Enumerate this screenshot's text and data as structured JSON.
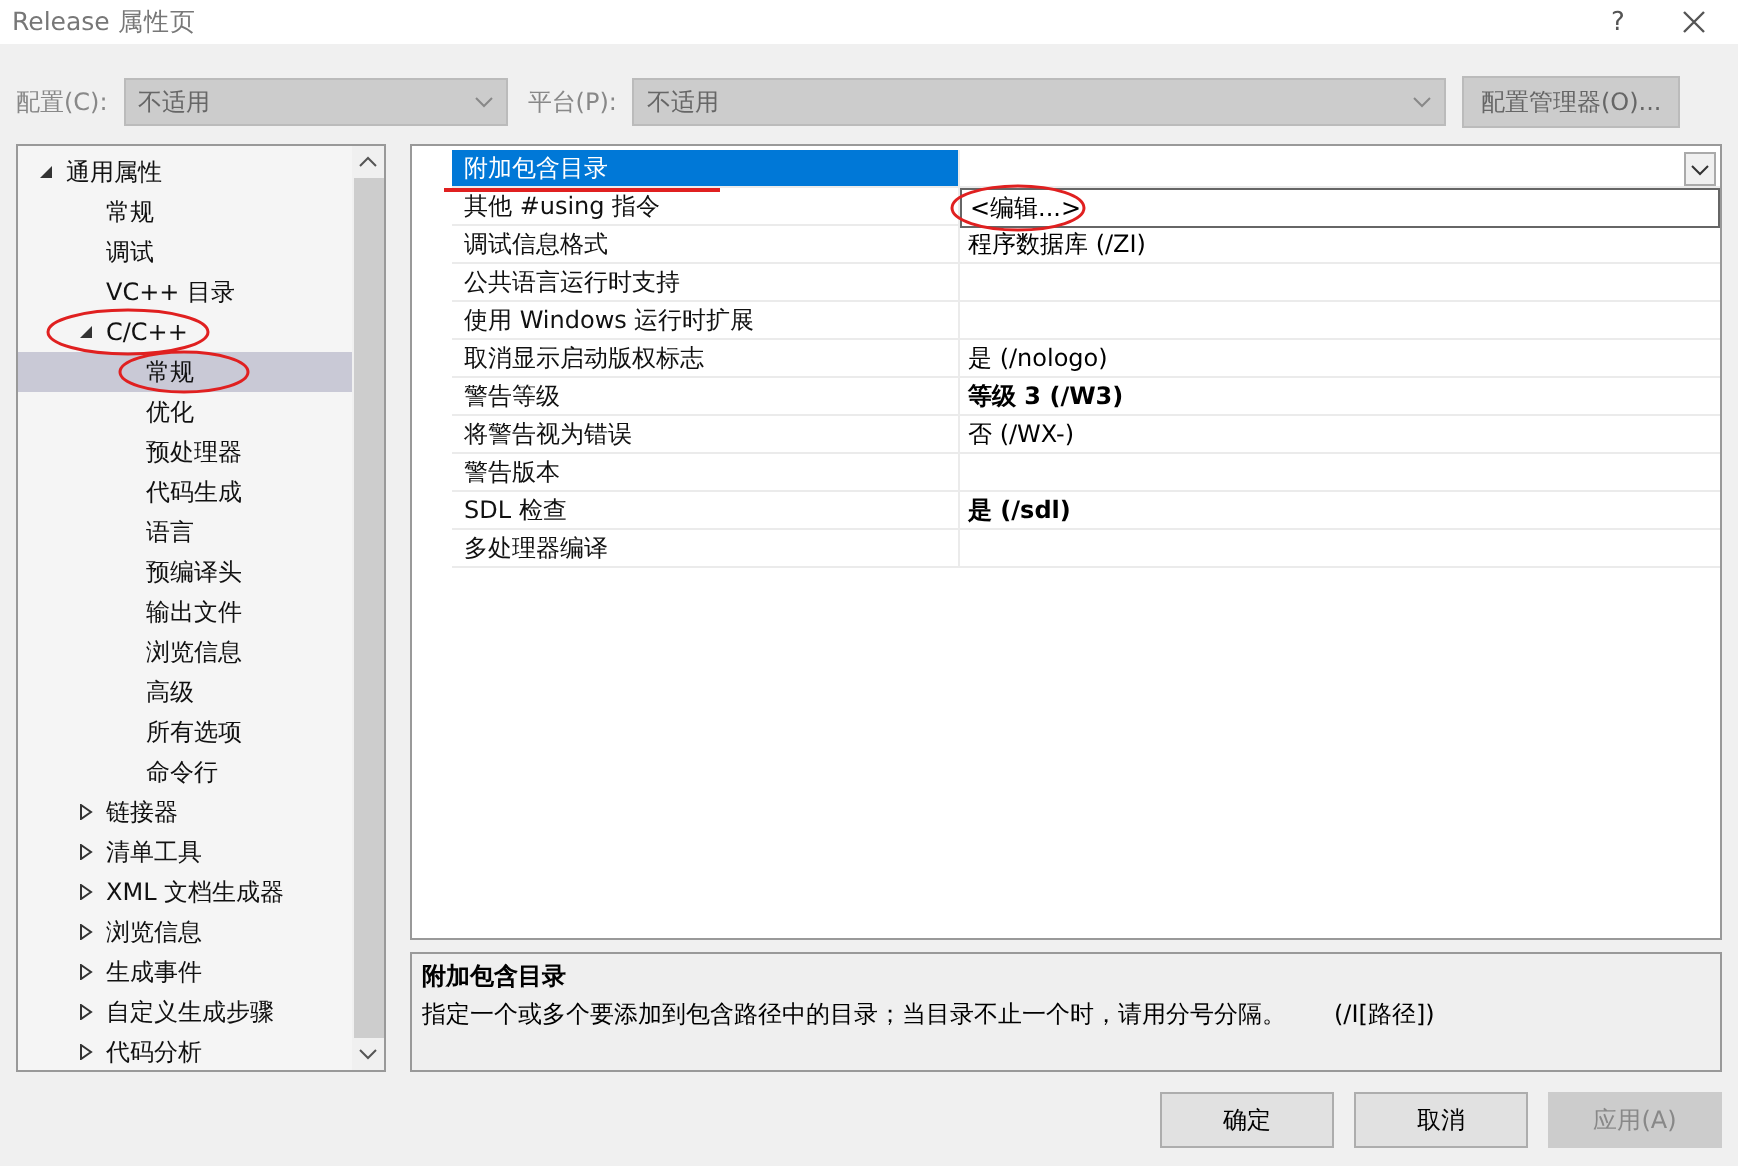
{
  "window": {
    "title": "Release 属性页",
    "help": "?"
  },
  "config_bar": {
    "config_label": "配置(C):",
    "config_value": "不适用",
    "platform_label": "平台(P):",
    "platform_value": "不适用",
    "manager_button": "配置管理器(O)...",
    "disabled": true
  },
  "tree": [
    {
      "label": "通用属性",
      "expanded": true,
      "selected": false,
      "children": [
        {
          "label": "常规",
          "selected": false
        },
        {
          "label": "调试",
          "selected": false
        },
        {
          "label": "VC++ 目录",
          "selected": false
        },
        {
          "label": "C/C++",
          "expanded": true,
          "selected": false,
          "annotated": true,
          "children": [
            {
              "label": "常规",
              "selected": true,
              "annotated": true
            },
            {
              "label": "优化",
              "selected": false
            },
            {
              "label": "预处理器",
              "selected": false
            },
            {
              "label": "代码生成",
              "selected": false
            },
            {
              "label": "语言",
              "selected": false
            },
            {
              "label": "预编译头",
              "selected": false
            },
            {
              "label": "输出文件",
              "selected": false
            },
            {
              "label": "浏览信息",
              "selected": false
            },
            {
              "label": "高级",
              "selected": false
            },
            {
              "label": "所有选项",
              "selected": false
            },
            {
              "label": "命令行",
              "selected": false
            }
          ]
        },
        {
          "label": "链接器",
          "expanded": false,
          "selected": false
        },
        {
          "label": "清单工具",
          "expanded": false,
          "selected": false
        },
        {
          "label": "XML 文档生成器",
          "expanded": false,
          "selected": false
        },
        {
          "label": "浏览信息",
          "expanded": false,
          "selected": false
        },
        {
          "label": "生成事件",
          "expanded": false,
          "selected": false
        },
        {
          "label": "自定义生成步骤",
          "expanded": false,
          "selected": false
        },
        {
          "label": "代码分析",
          "expanded": false,
          "selected": false
        }
      ]
    }
  ],
  "properties": [
    {
      "name": "附加包含目录",
      "selected": true,
      "annotated": true
    },
    {
      "name": "其他 #using 指令",
      "selected": false
    },
    {
      "name": "调试信息格式",
      "value": "程序数据库 (/ZI)",
      "selected": false,
      "bold": false
    },
    {
      "name": "公共语言运行时支持",
      "selected": false
    },
    {
      "name": "使用 Windows 运行时扩展",
      "selected": false
    },
    {
      "name": "取消显示启动版权标志",
      "value": "是 (/nologo)",
      "selected": false,
      "bold": false
    },
    {
      "name": "警告等级",
      "value": "等级 3 (/W3)",
      "selected": false,
      "bold": true
    },
    {
      "name": "将警告视为错误",
      "value": "否 (/WX-)",
      "selected": false,
      "bold": false
    },
    {
      "name": "警告版本",
      "selected": false
    },
    {
      "name": "SDL 检查",
      "value": "是 (/sdl)",
      "selected": false,
      "bold": true
    },
    {
      "name": "多处理器编译",
      "selected": false
    }
  ],
  "dropdown": {
    "option": "<编辑...>",
    "annotated": true
  },
  "description": {
    "title": "附加包含目录",
    "text": "指定一个或多个要添加到包含路径中的目录；当目录不止一个时，请用分号分隔。",
    "syntax": "(/I[路径])"
  },
  "buttons": [
    {
      "label": "确定",
      "disabled": false
    },
    {
      "label": "取消",
      "disabled": false
    },
    {
      "label": "应用(A)",
      "disabled": true
    }
  ]
}
